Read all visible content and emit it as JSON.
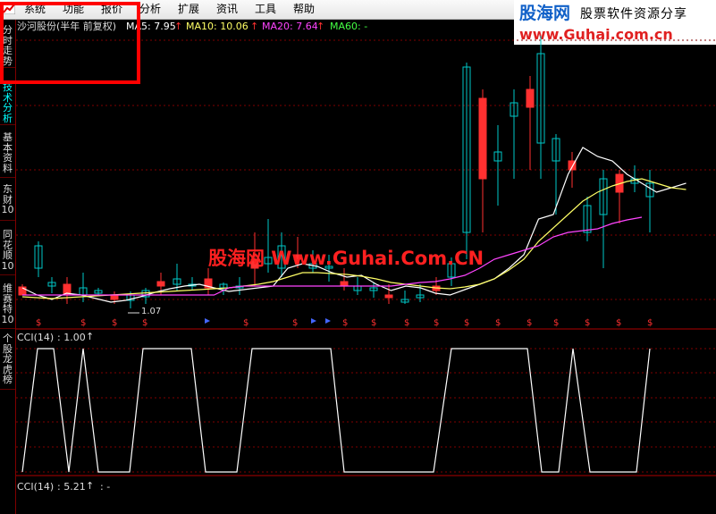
{
  "menu": {
    "items": [
      {
        "label": "系统"
      },
      {
        "label": "功能"
      },
      {
        "label": "报价"
      },
      {
        "label": "分析"
      },
      {
        "label": "扩展"
      },
      {
        "label": "资讯"
      },
      {
        "label": "工具"
      },
      {
        "label": "帮助"
      }
    ]
  },
  "brand": {
    "name": "股海网",
    "tagline": "股票软件资源分享",
    "url": "www.Guhai.com.cn"
  },
  "left_tabs": [
    {
      "label": "分时走势",
      "active": false
    },
    {
      "label": "技术分析",
      "active": true
    },
    {
      "label": "基本资料",
      "active": false
    },
    {
      "label": "东财10",
      "active": false
    },
    {
      "label": "同花顺10",
      "active": false
    },
    {
      "label": "维赛特10",
      "active": false
    },
    {
      "label": "个股龙虎榜",
      "active": false
    }
  ],
  "legend": {
    "stock_name": "沙河股份(半年 前复权)",
    "ma5_label": "MA5: 7.95",
    "ma10_label": "MA10: 10.06",
    "ma20_label": "MA20: 7.64",
    "ma60_label": "MA60: -",
    "colors": {
      "stock": "#dddddd",
      "ma5": "#ffffff",
      "ma10": "#ffff66",
      "ma20": "#ff44ff",
      "ma60": "#44ff44",
      "arrow": "#ff3030"
    }
  },
  "watermark": "股海网 Www.Guhai.Com.CN",
  "low_label": "1.07",
  "marker_symbol": "$",
  "cci_panel": {
    "label": "CCI(14)",
    "value": ": 1.00",
    "line_color": "#ffffff"
  },
  "cci_panel2": {
    "label": "CCI(14)",
    "value": ": 5.21",
    "extra": ": -"
  },
  "chart_data": {
    "type": "line",
    "series": [
      {
        "name": "MA5",
        "color": "#ffffff",
        "values": [
          322,
          330,
          335,
          328,
          330,
          334,
          338,
          336,
          332,
          327,
          323,
          320,
          318,
          322,
          326,
          324,
          322,
          320,
          300,
          295,
          298,
          305,
          310,
          308,
          318,
          325,
          320,
          322,
          328,
          330,
          324,
          318,
          312,
          300,
          285,
          245,
          240,
          195,
          165,
          175,
          180,
          195,
          205,
          215,
          210,
          205
        ]
      },
      {
        "name": "MA10",
        "color": "#ffff66",
        "values": [
          332,
          333,
          334,
          333,
          332,
          331,
          330,
          329,
          328,
          327,
          326,
          325,
          324,
          323,
          322,
          320,
          318,
          315,
          310,
          305,
          305,
          306,
          307,
          309,
          312,
          316,
          318,
          320,
          322,
          323,
          321,
          318,
          312,
          302,
          290,
          270,
          255,
          240,
          225,
          215,
          208,
          203,
          200,
          205,
          210,
          212
        ]
      },
      {
        "name": "MA20",
        "color": "#ff44ff",
        "values": [
          330,
          330,
          330,
          330,
          330,
          330,
          330,
          330,
          330,
          330,
          330,
          330,
          330,
          330,
          322,
          320,
          320,
          320,
          320,
          320,
          320,
          320,
          320,
          320,
          320,
          320,
          318,
          316,
          315,
          312,
          308,
          300,
          290,
          285,
          280,
          275,
          265,
          260,
          258,
          256,
          250,
          246,
          243
        ]
      }
    ],
    "cci_values": [
      {
        "name": "CCI(14)",
        "value": 1.0
      },
      {
        "name": "CCI(14)",
        "value": 5.21
      }
    ]
  }
}
